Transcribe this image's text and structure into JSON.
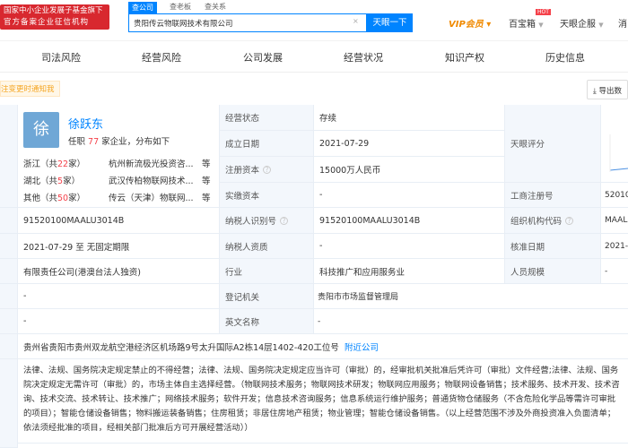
{
  "header": {
    "logo_line1": "国家中小企业发展子基金旗下",
    "logo_line2": "官方备案企业征信机构",
    "tabs": [
      "查公司",
      "查老板",
      "查关系"
    ],
    "search_value": "贵阳传云物联网技术有限公司",
    "search_button": "天眼一下",
    "vip": "VIP会员",
    "baobox": "百宝箱",
    "hot": "HOT",
    "qifu": "天眼企服",
    "more": "消"
  },
  "nav": [
    "司法风险",
    "经营风险",
    "公司发展",
    "经营状况",
    "知识产权",
    "历史信息"
  ],
  "notice": "注变更时通知我",
  "export": "导出数",
  "person": {
    "avatar": "徐",
    "name": "徐跃东",
    "pre": "任职",
    "count": "77",
    "post": "家企业，分布如下",
    "regions": [
      {
        "pre": "浙江（共",
        "n": "22",
        "post": "家）",
        "company": "杭州新流极光投资咨...",
        "etc": "等"
      },
      {
        "pre": "湖北（共",
        "n": "5",
        "post": "家）",
        "company": "武汉传柏物联网技术...",
        "etc": "等"
      },
      {
        "pre": "其他（共",
        "n": "50",
        "post": "家）",
        "company": "传云（天津）物联网...",
        "etc": "等"
      }
    ]
  },
  "rows": [
    {
      "l1": "经营状态",
      "v1": "存续"
    },
    {
      "l1": "成立日期",
      "v1": "2021-07-29"
    },
    {
      "l1": "注册资本",
      "v1": "15000万人民币"
    },
    {
      "l1": "实缴资本",
      "v1": "-",
      "l2": "工商注册号",
      "v2": "52010"
    },
    {
      "v0": "91520100MAALU3014B",
      "l1": "纳税人识别号",
      "v1": "91520100MAALU3014B",
      "l2": "组织机构代码",
      "v2": "MAAL"
    },
    {
      "v0": "2021-07-29 至 无固定期限",
      "l1": "纳税人资质",
      "v1": "-",
      "l2": "核准日期",
      "v2": "2021-"
    },
    {
      "v0": "有限责任公司(港澳台法人独资)",
      "l1": "行业",
      "v1": "科技推广和应用服务业",
      "l2": "人员规模",
      "v2": "-"
    },
    {
      "v0": "-",
      "l1": "登记机关",
      "v1": "贵阳市市场监督管理局"
    },
    {
      "v0": "-",
      "l1": "英文名称",
      "v1": "-"
    }
  ],
  "score_label": "天眼评分",
  "address": "贵州省贵阳市贵州双龙航空港经济区机场路9号太升国际A2栋14层1402-420工位号",
  "nearby": "附近公司",
  "scope": "法律、法规、国务院决定规定禁止的不得经营；法律、法规、国务院决定规定应当许可（审批）的，经审批机关批准后凭许可（审批）文件经营;法律、法规、国务院决定规定无需许可（审批）的，市场主体自主选择经营。（物联网技术服务；物联网技术研发；物联网应用服务；物联网设备销售；技术服务、技术开发、技术咨询、技术交流、技术转让、技术推广；网络技术服务；软件开发；信息技术咨询服务；信息系统运行维护服务；普通货物仓储服务（不含危险化学品等需许可审批的项目）；智能仓储设备销售；物料搬运装备销售；住房租赁；非居住房地产租赁；物业管理；智能仓储设备销售。（以上经营范围不涉及外商投资准入负面清单；依法须经批准的项目，经相关部门批准后方可开展经营活动））"
}
